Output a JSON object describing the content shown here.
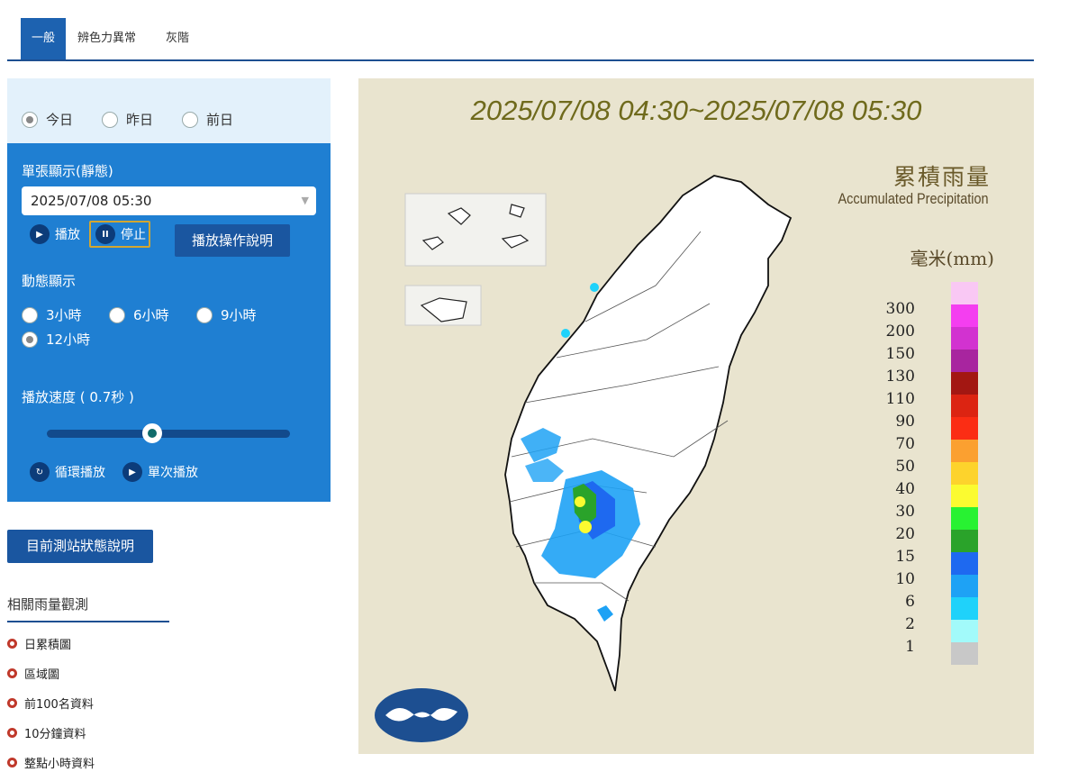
{
  "tabs": [
    {
      "label": "一般",
      "active": true
    },
    {
      "label": "辨色力異常",
      "active": false
    },
    {
      "label": "灰階",
      "active": false
    }
  ],
  "day_options": [
    {
      "label": "今日",
      "selected": true
    },
    {
      "label": "昨日",
      "selected": false
    },
    {
      "label": "前日",
      "selected": false
    }
  ],
  "static": {
    "label": "單張顯示(靜態)",
    "selected_time": "2025/07/08 05:30",
    "play_label": "播放",
    "stop_label": "停止",
    "help_button": "播放操作說明"
  },
  "dynamic": {
    "label": "動態顯示",
    "options": [
      {
        "label": "3小時",
        "selected": false
      },
      {
        "label": "6小時",
        "selected": false
      },
      {
        "label": "9小時",
        "selected": false
      },
      {
        "label": "12小時",
        "selected": true
      }
    ]
  },
  "speed": {
    "label": "播放速度 ( 0.7秒 )",
    "slider_level": 0.46
  },
  "loop_play": "循環播放",
  "single_play": "單次播放",
  "station_status_button": "目前測站狀態說明",
  "related": {
    "title": "相關雨量觀測",
    "items": [
      "日累積圖",
      "區域圖",
      "前100名資料",
      "10分鐘資料",
      "整點小時資料"
    ]
  },
  "map": {
    "time_range": "2025/07/08 04:30~2025/07/08 05:30",
    "title_zh": "累積雨量",
    "title_en": "Accumulated Precipitation",
    "unit": "毫米(mm)",
    "legend": [
      {
        "label": "300",
        "color": "#f9c8f4"
      },
      {
        "label": "200",
        "color": "#f43ef0"
      },
      {
        "label": "150",
        "color": "#d232d0"
      },
      {
        "label": "130",
        "color": "#a8259f"
      },
      {
        "label": "110",
        "color": "#a31712"
      },
      {
        "label": "90",
        "color": "#dc2412"
      },
      {
        "label": "70",
        "color": "#fb2d14"
      },
      {
        "label": "50",
        "color": "#fba030"
      },
      {
        "label": "40",
        "color": "#fdd32c"
      },
      {
        "label": "30",
        "color": "#fbfb30"
      },
      {
        "label": "20",
        "color": "#28f232"
      },
      {
        "label": "15",
        "color": "#2aa32a"
      },
      {
        "label": "10",
        "color": "#1e69f0"
      },
      {
        "label": "6",
        "color": "#1ea2f5"
      },
      {
        "label": "2",
        "color": "#1fd2fa"
      },
      {
        "label": "1",
        "color": "#a2fafa"
      },
      {
        "label": "",
        "color": "#c8c8c8"
      }
    ]
  }
}
